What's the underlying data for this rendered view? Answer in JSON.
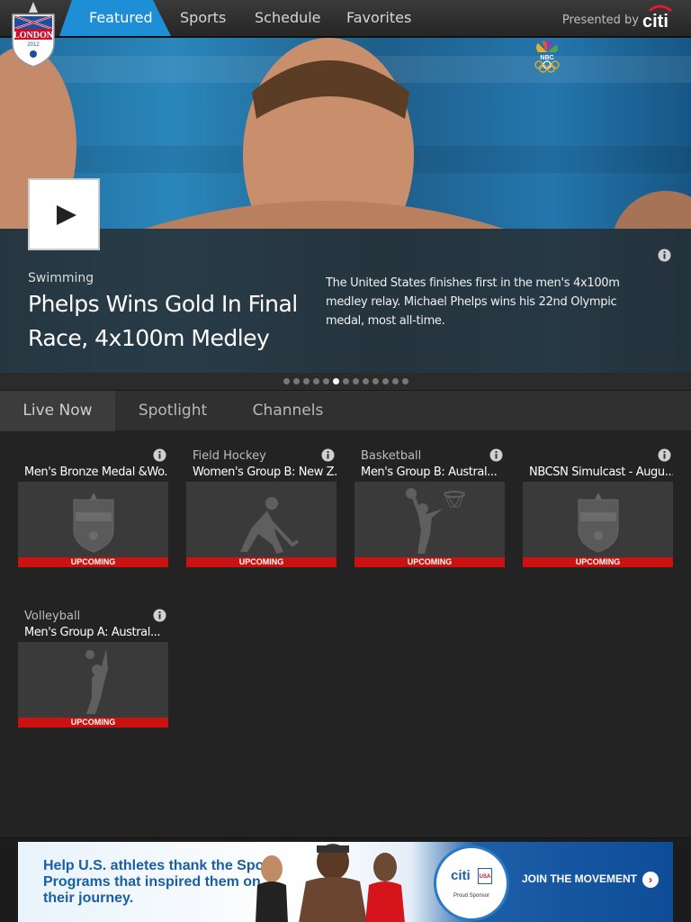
{
  "nav": {
    "tabs": [
      {
        "label": "Featured",
        "active": true
      },
      {
        "label": "Sports",
        "active": false
      },
      {
        "label": "Schedule",
        "active": false
      },
      {
        "label": "Favorites",
        "active": false
      }
    ],
    "presented_by": "Presented by",
    "sponsor_logo_text": "citi",
    "logo_text": "LONDON",
    "logo_year": "2012"
  },
  "hero": {
    "category": "Swimming",
    "title": "Phelps Wins Gold In Final Race, 4x100m Medley",
    "description": "The United States finishes first in the men's 4x100m medley relay. Michael Phelps wins his 22nd Olympic medal, most all-time.",
    "network_logo": "NBC",
    "pager": {
      "total": 13,
      "active_index": 5
    }
  },
  "subtabs": [
    {
      "label": "Live Now",
      "active": true
    },
    {
      "label": "Spotlight",
      "active": false
    },
    {
      "label": "Channels",
      "active": false
    }
  ],
  "cards": [
    {
      "sport": "",
      "title": "Men's Bronze Medal &Wo...",
      "status": "UPCOMING",
      "icon": "london-2012-crest-icon"
    },
    {
      "sport": "Field Hockey",
      "title": "Women's Group B: New Z...",
      "status": "UPCOMING",
      "icon": "field-hockey-icon"
    },
    {
      "sport": "Basketball",
      "title": "Men's Group B: Austral...",
      "status": "UPCOMING",
      "icon": "basketball-icon"
    },
    {
      "sport": "",
      "title": "NBCSN Simulcast - Augu...",
      "status": "UPCOMING",
      "icon": "london-2012-crest-icon"
    },
    {
      "sport": "Volleyball",
      "title": "Men's Group A: Austral...",
      "status": "UPCOMING",
      "icon": "volleyball-icon"
    }
  ],
  "ad": {
    "headline": "Help U.S. athletes thank the Sport Programs that inspired them on their journey.",
    "brand": "citi",
    "badge": "USA",
    "sponsor_line": "Proud Sponsor",
    "cta": "JOIN THE MOVEMENT"
  },
  "colors": {
    "accent_tab": "#1e8fd6",
    "upcoming_badge": "#cc1111",
    "citi_red": "#e31837"
  }
}
